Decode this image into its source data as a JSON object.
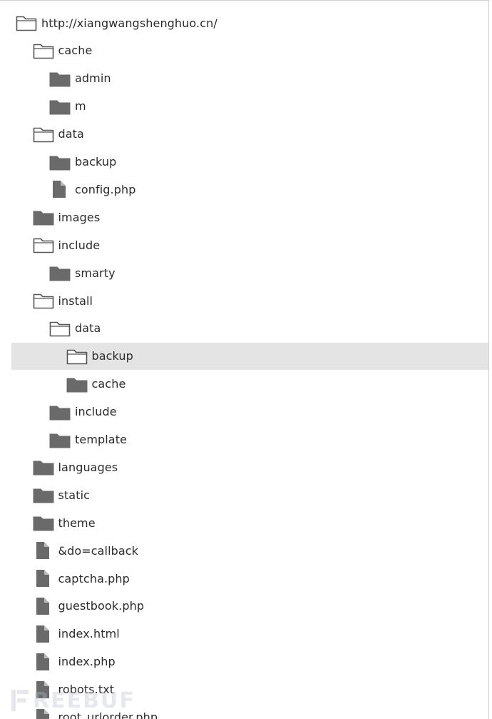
{
  "tree": {
    "items": [
      {
        "label": "http://xiangwangshenghuo.cn/",
        "icon": "folder-open-icon",
        "type": "folder-open"
      },
      {
        "label": "cache",
        "icon": "folder-open-icon",
        "type": "folder-open"
      },
      {
        "label": "admin",
        "icon": "folder-closed-icon",
        "type": "folder-closed"
      },
      {
        "label": "m",
        "icon": "folder-closed-icon",
        "type": "folder-closed"
      },
      {
        "label": "data",
        "icon": "folder-open-icon",
        "type": "folder-open"
      },
      {
        "label": "backup",
        "icon": "folder-closed-icon",
        "type": "folder-closed"
      },
      {
        "label": "config.php",
        "icon": "file-icon",
        "type": "file"
      },
      {
        "label": "images",
        "icon": "folder-closed-icon",
        "type": "folder-closed"
      },
      {
        "label": "include",
        "icon": "folder-open-icon",
        "type": "folder-open"
      },
      {
        "label": "smarty",
        "icon": "folder-closed-icon",
        "type": "folder-closed"
      },
      {
        "label": "install",
        "icon": "folder-open-icon",
        "type": "folder-open"
      },
      {
        "label": "data",
        "icon": "folder-open-icon",
        "type": "folder-open"
      },
      {
        "label": "backup",
        "icon": "folder-open-icon",
        "type": "folder-open",
        "selected": true
      },
      {
        "label": "cache",
        "icon": "folder-closed-icon",
        "type": "folder-closed"
      },
      {
        "label": "include",
        "icon": "folder-closed-icon",
        "type": "folder-closed"
      },
      {
        "label": "template",
        "icon": "folder-closed-icon",
        "type": "folder-closed"
      },
      {
        "label": "languages",
        "icon": "folder-closed-icon",
        "type": "folder-closed"
      },
      {
        "label": "static",
        "icon": "folder-closed-icon",
        "type": "folder-closed"
      },
      {
        "label": "theme",
        "icon": "folder-closed-icon",
        "type": "folder-closed"
      },
      {
        "label": "&do=callback",
        "icon": "file-icon",
        "type": "file"
      },
      {
        "label": "captcha.php",
        "icon": "file-icon",
        "type": "file"
      },
      {
        "label": "guestbook.php",
        "icon": "file-icon",
        "type": "file"
      },
      {
        "label": "index.html",
        "icon": "file-icon",
        "type": "file"
      },
      {
        "label": "index.php",
        "icon": "file-icon",
        "type": "file"
      },
      {
        "label": "robots.txt",
        "icon": "file-icon",
        "type": "file"
      },
      {
        "label": "root_urlorder.php",
        "icon": "file-icon",
        "type": "file"
      }
    ]
  },
  "watermark": {
    "text": "REEBUF"
  },
  "colors": {
    "icon_fill": "#6a6a6a",
    "icon_outline": "#555555",
    "selected_bg": "#e4e4e4",
    "text": "#2b2b2b"
  }
}
